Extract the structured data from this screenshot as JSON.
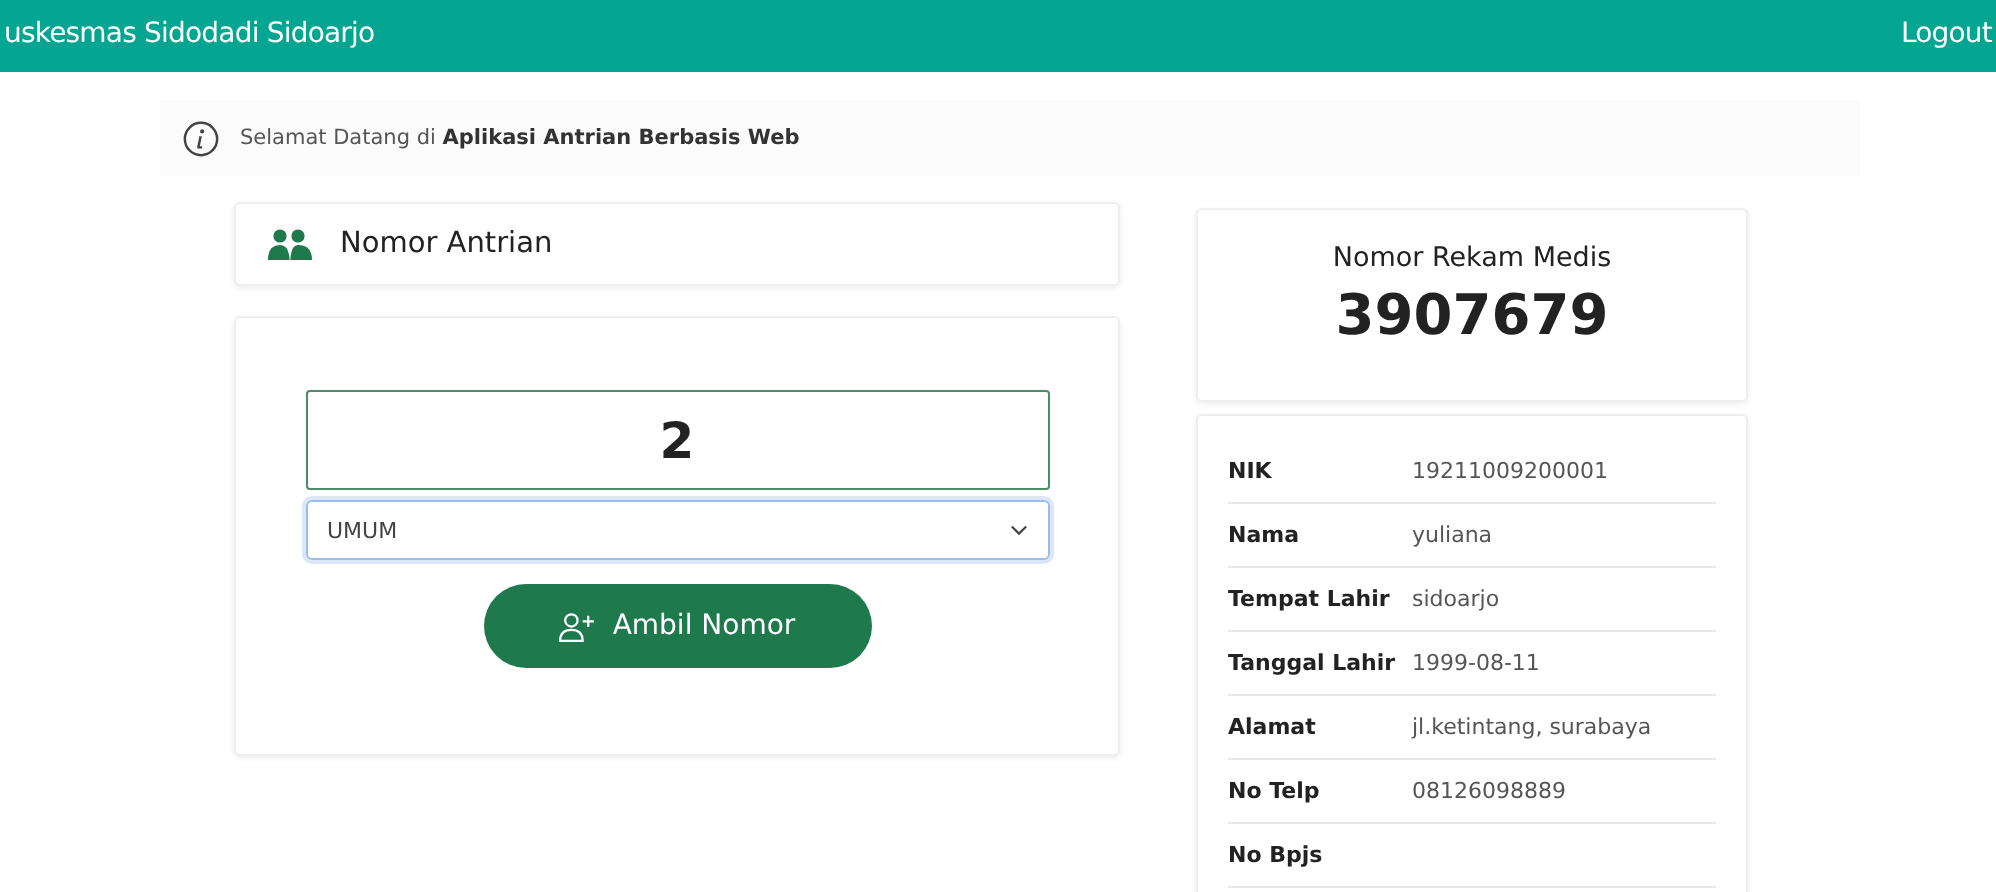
{
  "navbar": {
    "brand": "uskesmas Sidodadi Sidoarjo",
    "logout": "Logout"
  },
  "alert": {
    "text": "Selamat Datang di **Aplikasi Antrian Berbasis Web**"
  },
  "queue": {
    "title": "Nomor Antrian",
    "number": "2",
    "category": "UMUM",
    "button": "Ambil Nomor"
  },
  "record": {
    "label": "Nomor Rekam Medis",
    "number": "3907679"
  },
  "patient": [
    {
      "label": "NIK",
      "value": "19211009200001"
    },
    {
      "label": "Nama",
      "value": "yuliana"
    },
    {
      "label": "Tempat Lahir",
      "value": "sidoarjo"
    },
    {
      "label": "Tanggal Lahir",
      "value": "1999-08-11"
    },
    {
      "label": "Alamat",
      "value": "jl.ketintang, surabaya"
    },
    {
      "label": "No Telp",
      "value": "08126098889"
    },
    {
      "label": "No Bpjs"
    }
  ]
}
